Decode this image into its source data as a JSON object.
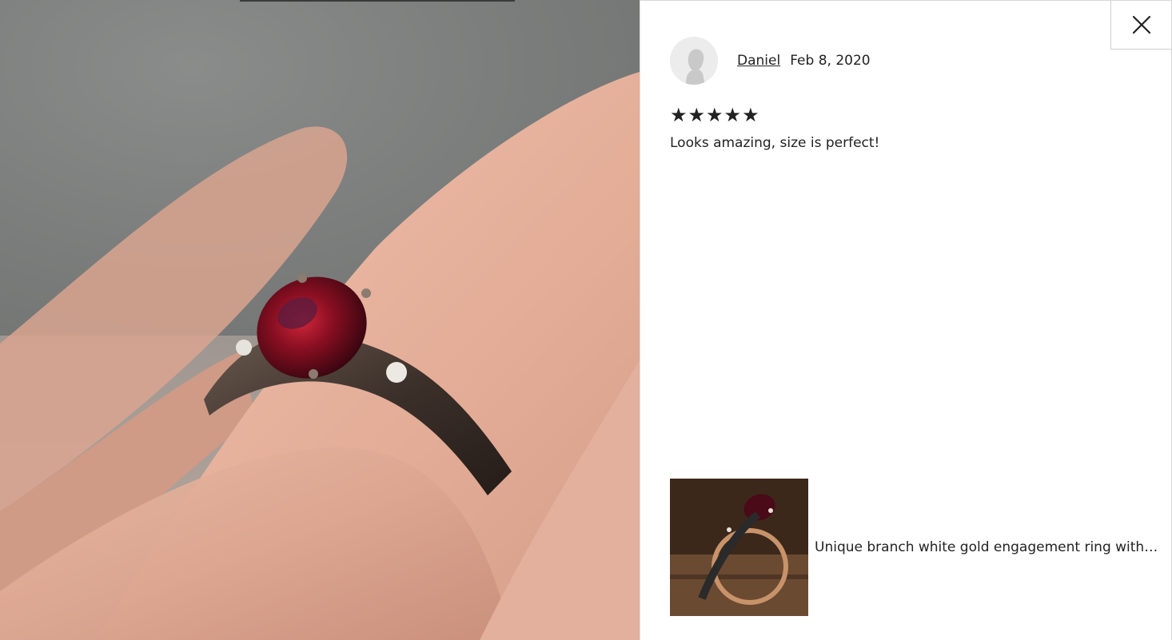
{
  "photo": {
    "alt_subject": "ring-on-finger-photo"
  },
  "close": {
    "icon": "close-icon"
  },
  "review": {
    "reviewer_name": "Daniel",
    "date": "Feb 8, 2020",
    "rating": 5,
    "rating_max": 5,
    "text": "Looks amazing, size is perfect!"
  },
  "product": {
    "title": "Unique branch white gold engagement ring with ..."
  },
  "colors": {
    "text": "#222222",
    "star": "#222222",
    "border": "#d0d0d0",
    "avatar_bg": "#ececec"
  }
}
